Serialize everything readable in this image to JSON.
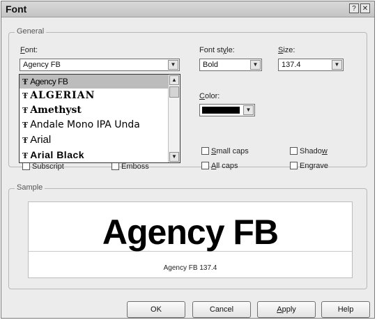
{
  "window": {
    "title": "Font",
    "help_glyph": "?",
    "close_glyph": "✕"
  },
  "general": {
    "group_label": "General",
    "font_label_u": "F",
    "font_label_rest": "ont:",
    "font_value": "Agency FB",
    "style_label_pre": "Font st",
    "style_label_u": "y",
    "style_label_post": "le:",
    "style_value": "Bold",
    "size_label_u": "S",
    "size_label_rest": "ize:",
    "size_value": "137.4",
    "color_label_u": "C",
    "color_label_rest": "olor:",
    "color_swatch": "#000000"
  },
  "font_list": {
    "items": [
      "Agency FB",
      "ALGERIAN",
      "Amethyst",
      "Andale Mono IPA Unda",
      "Arial",
      "Arial Black"
    ],
    "selected_index": 0,
    "truetype_glyph": "Ŧ"
  },
  "effects": {
    "subscript": "Subscript",
    "emboss": "Emboss",
    "small_caps_u": "S",
    "small_caps_rest": "mall caps",
    "all_caps_u": "A",
    "all_caps_rest": "ll caps",
    "shadow_pre": "Shado",
    "shadow_u": "w",
    "engrave": "Engrave"
  },
  "sample": {
    "group_label": "Sample",
    "preview_text": "Agency FB",
    "caption": "Agency FB 137.4"
  },
  "buttons": {
    "ok": "OK",
    "cancel": "Cancel",
    "apply_u": "A",
    "apply_rest": "pply",
    "help": "Help"
  },
  "arrows": {
    "down": "▼",
    "up": "▲"
  }
}
